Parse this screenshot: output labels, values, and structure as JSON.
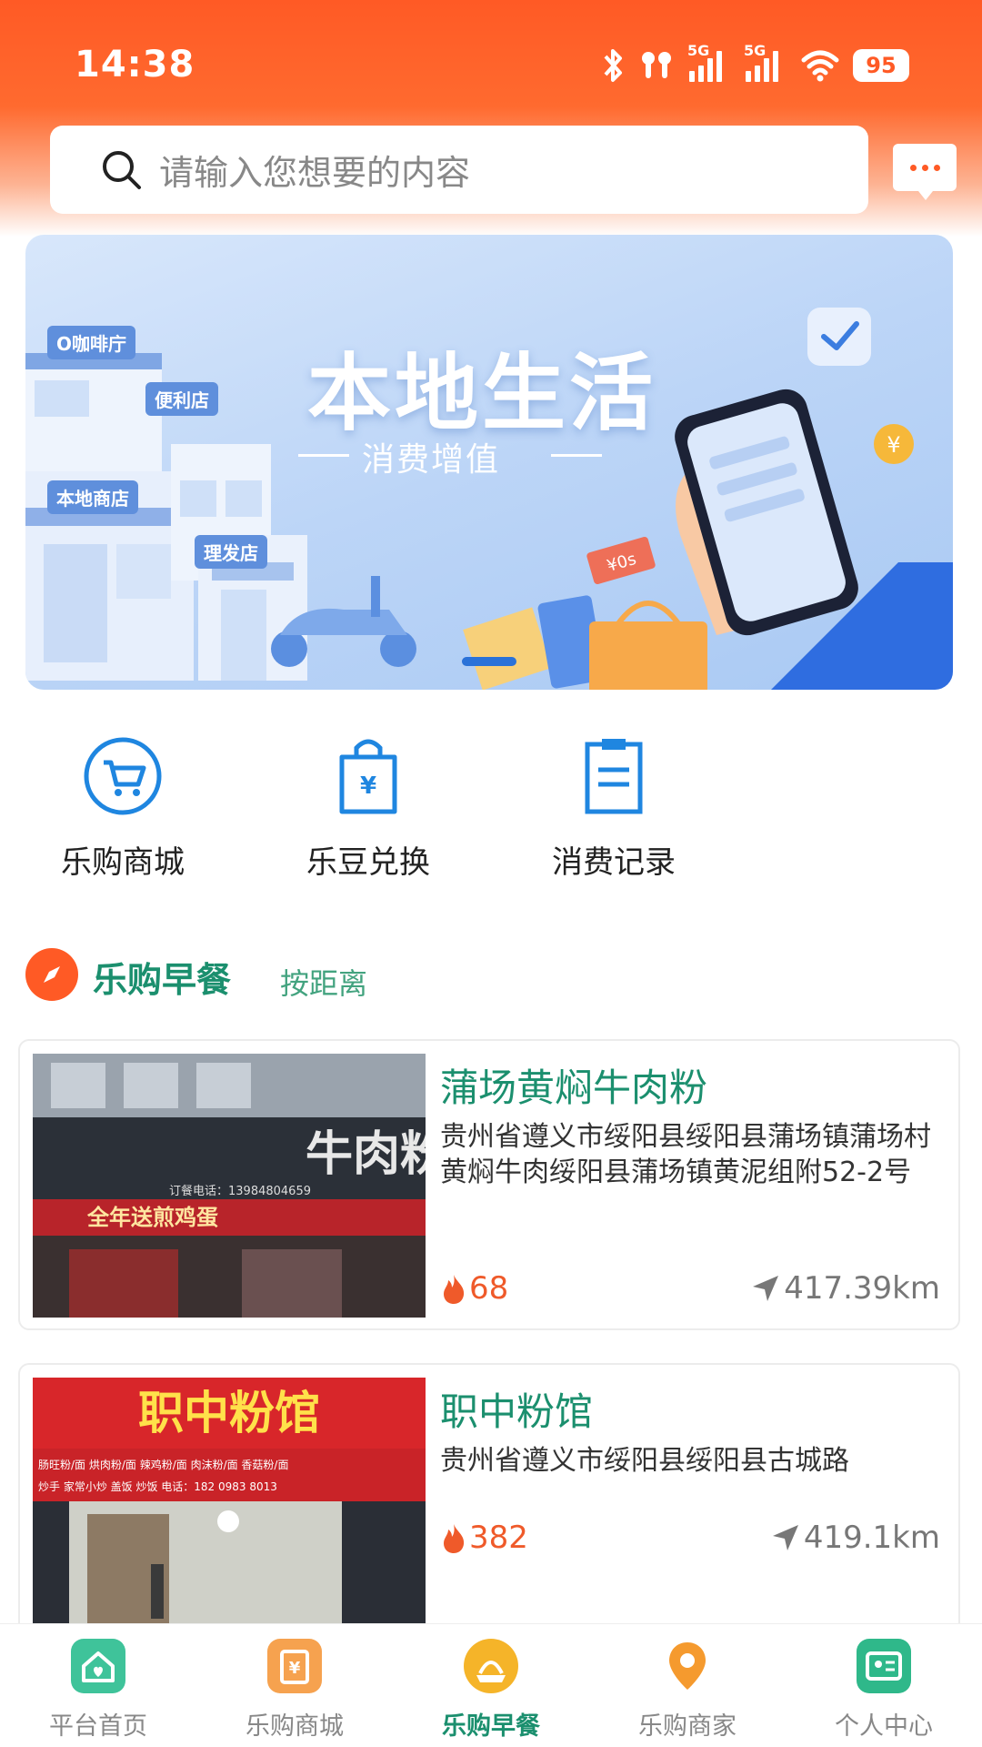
{
  "status_bar": {
    "time": "14:38",
    "battery": "95",
    "sim1_label": "5G",
    "sim2_label": "5G"
  },
  "search": {
    "placeholder": "请输入您想要的内容"
  },
  "banner": {
    "title": "本地生活",
    "subtitle": "消费增值",
    "shop_tags": [
      "O咖啡庁",
      "便利店",
      "本地商店",
      "理发店"
    ],
    "ticket_text": "¥0s"
  },
  "quick_menu": [
    {
      "label": "乐购商城",
      "icon": "cart-icon"
    },
    {
      "label": "乐豆兑换",
      "icon": "shopping-bag-yen-icon"
    },
    {
      "label": "消费记录",
      "icon": "clipboard-icon"
    }
  ],
  "section": {
    "title": "乐购早餐",
    "sort_label": "按距离",
    "icon": "compass-icon"
  },
  "shops": [
    {
      "name": "蒲场黄焖牛肉粉",
      "address": "贵州省遵义市绥阳县绥阳县蒲场镇蒲场村黄焖牛肉绥阳县蒲场镇黄泥组附52-2号",
      "hot": "68",
      "distance": "417.39km",
      "photo_sign": "牛肉粉",
      "photo_phone": "订餐电话：13984804659",
      "photo_banner": "全年送煎鸡蛋"
    },
    {
      "name": "职中粉馆",
      "address": "贵州省遵义市绥阳县绥阳县古城路",
      "hot": "382",
      "distance": "419.1km",
      "photo_sign": "职中粉馆",
      "photo_menu": "肠旺粉/面  烘肉粉/面  辣鸡粉/面  肉沫粉/面  香菇粉/面",
      "photo_sub": "炒手  家常小炒  盖饭  炒饭   电话：182 0983 8013"
    }
  ],
  "bottom_nav": [
    {
      "label": "平台首页",
      "icon": "home-icon",
      "color": "#3fc39a",
      "active": false
    },
    {
      "label": "乐购商城",
      "icon": "mall-icon",
      "color": "#f6a24f",
      "active": false
    },
    {
      "label": "乐购早餐",
      "icon": "breakfast-icon",
      "color": "#f5b429",
      "active": true
    },
    {
      "label": "乐购商家",
      "icon": "location-pin-icon",
      "color": "#f59a2e",
      "active": false
    },
    {
      "label": "个人中心",
      "icon": "profile-card-icon",
      "color": "#2fb88a",
      "active": false
    }
  ],
  "colors": {
    "accent": "#ff5a25",
    "green": "#1b8f6e",
    "blue_icon": "#1f86e0"
  }
}
